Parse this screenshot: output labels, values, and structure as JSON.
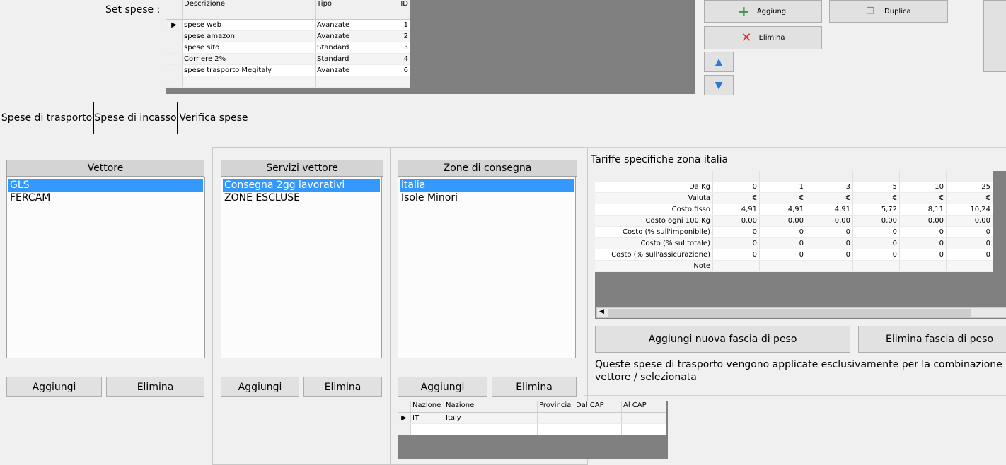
{
  "set_spese": {
    "label": "Set spese :",
    "columns": [
      "Descrizione",
      "Tipo",
      "ID"
    ],
    "rows": [
      {
        "descrizione": "spese web",
        "tipo": "Avanzate",
        "id": "1"
      },
      {
        "descrizione": "spese amazon",
        "tipo": "Avanzate",
        "id": "2"
      },
      {
        "descrizione": "spese sito",
        "tipo": "Standard",
        "id": "3"
      },
      {
        "descrizione": "Corriere 2%",
        "tipo": "Standard",
        "id": "4"
      },
      {
        "descrizione": "spese trasporto Megitaly",
        "tipo": "Avanzate",
        "id": "6"
      }
    ]
  },
  "toolbar": {
    "aggiungi": "Aggiungi",
    "duplica": "Duplica",
    "elimina": "Elimina"
  },
  "tabs": [
    "Spese di trasporto",
    "Spese di incasso",
    "Verifica spese"
  ],
  "vettore": {
    "header": "Vettore",
    "items": [
      "GLS",
      "FERCAM"
    ],
    "add": "Aggiungi",
    "delete": "Elimina"
  },
  "servizi": {
    "header": "Servizi vettore",
    "items": [
      "Consegna 2gg lavorativi",
      "ZONE ESCLUSE"
    ],
    "add": "Aggiungi",
    "delete": "Elimina"
  },
  "zone": {
    "header": "Zone di consegna",
    "items": [
      "italia",
      "Isole Minori"
    ],
    "add": "Aggiungi",
    "delete": "Elimina"
  },
  "nazioni": {
    "columns": [
      "Nazione",
      "Nazione",
      "Provincia",
      "Dal CAP",
      "Al CAP"
    ],
    "rows": [
      {
        "code": "IT",
        "name": "Italy",
        "provincia": "",
        "dal": "",
        "al": ""
      }
    ]
  },
  "tariffe": {
    "title": "Tariffe specifiche zona italia",
    "rows": [
      {
        "label": "Da Kg",
        "values": [
          "0",
          "1",
          "3",
          "5",
          "10",
          "25"
        ]
      },
      {
        "label": "Valuta",
        "values": [
          "€",
          "€",
          "€",
          "€",
          "€",
          "€"
        ]
      },
      {
        "label": "Costo fisso",
        "values": [
          "4,91",
          "4,91",
          "4,91",
          "5,72",
          "8,11",
          "10,24"
        ]
      },
      {
        "label": "Costo ogni 100 Kg",
        "values": [
          "0,00",
          "0,00",
          "0,00",
          "0,00",
          "0,00",
          "0,00"
        ]
      },
      {
        "label": "Costo (% sull'imponibile)",
        "values": [
          "0",
          "0",
          "0",
          "0",
          "0",
          "0"
        ]
      },
      {
        "label": "Costo (% sul totale)",
        "values": [
          "0",
          "0",
          "0",
          "0",
          "0",
          "0"
        ]
      },
      {
        "label": "Costo (% sull'assicurazione)",
        "values": [
          "0",
          "0",
          "0",
          "0",
          "0",
          "0"
        ]
      },
      {
        "label": "Note",
        "values": [
          "",
          "",
          "",
          "",
          "",
          ""
        ]
      }
    ],
    "add_fascia": "Aggiungi nuova fascia di peso",
    "del_fascia": "Elimina fascia di peso",
    "note": "Queste spese di trasporto vengono applicate esclusivamente per la combinazione vettore / selezionata"
  },
  "colors": {
    "selection": "#3399ff",
    "grid_bg": "#808080",
    "add_icon": "#2e9a3c",
    "delete_icon": "#e03030",
    "arrow_icon": "#2b7bd6"
  }
}
